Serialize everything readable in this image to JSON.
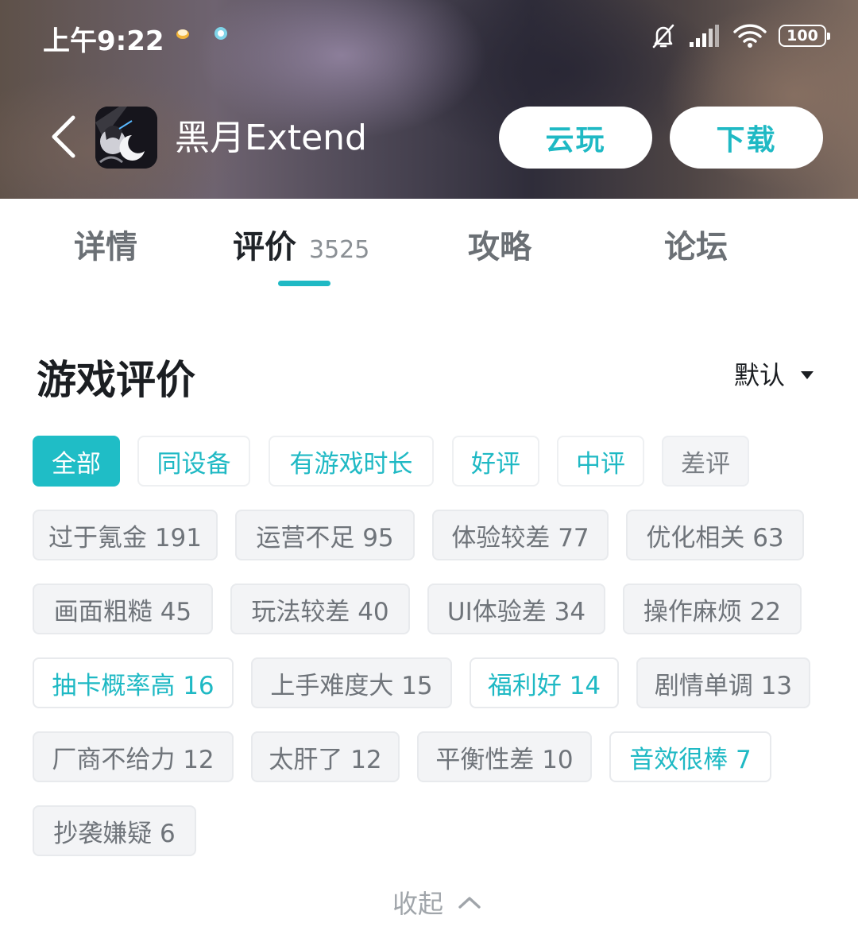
{
  "status_bar": {
    "time": "上午9:22",
    "battery": "100"
  },
  "header": {
    "app_name": "黑月Extend",
    "cloud_play_label": "云玩",
    "download_label": "下载"
  },
  "tabs": [
    {
      "label": "详情"
    },
    {
      "label": "评价",
      "count": "3525"
    },
    {
      "label": "攻略"
    },
    {
      "label": "论坛"
    }
  ],
  "section": {
    "title": "游戏评价",
    "sort_label": "默认"
  },
  "filters": [
    {
      "label": "全部"
    },
    {
      "label": "同设备"
    },
    {
      "label": "有游戏时长"
    },
    {
      "label": "好评"
    },
    {
      "label": "中评"
    },
    {
      "label": "差评"
    }
  ],
  "keyword_tags": [
    {
      "label": "过于氪金 191"
    },
    {
      "label": "运营不足 95"
    },
    {
      "label": "体验较差 77"
    },
    {
      "label": "优化相关 63"
    },
    {
      "label": "画面粗糙 45"
    },
    {
      "label": "玩法较差 40"
    },
    {
      "label": "UI体验差 34"
    },
    {
      "label": "操作麻烦 22"
    },
    {
      "label": "抽卡概率高 16"
    },
    {
      "label": "上手难度大 15"
    },
    {
      "label": "福利好 14"
    },
    {
      "label": "剧情单调 13"
    },
    {
      "label": "厂商不给力 12"
    },
    {
      "label": "太肝了 12"
    },
    {
      "label": "平衡性差 10"
    },
    {
      "label": "音效很棒 7"
    },
    {
      "label": "抄袭嫌疑 6"
    }
  ],
  "collapse_label": "收起",
  "colors": {
    "accent": "#1fb9c4",
    "text_dark": "#1b1e22",
    "tag_gray_bg": "#f3f4f6"
  }
}
